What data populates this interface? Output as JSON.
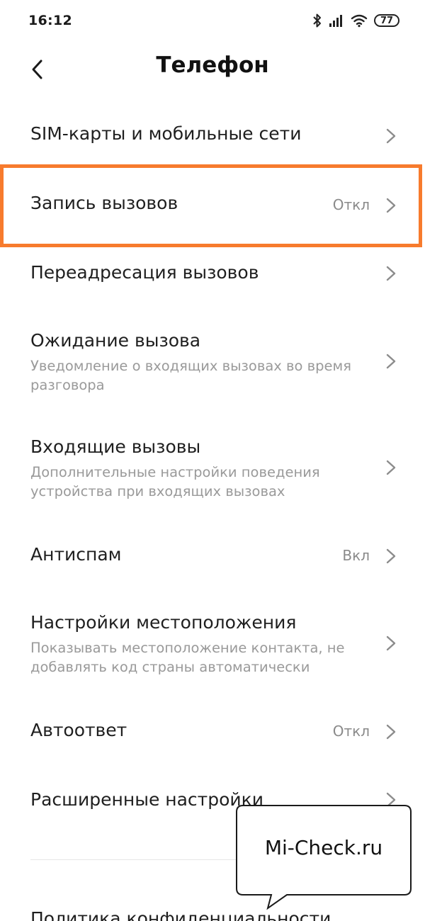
{
  "status_bar": {
    "time": "16:12",
    "battery": "77",
    "icons": [
      "bluetooth-icon",
      "signal-icon",
      "wifi-icon",
      "battery-icon"
    ]
  },
  "header": {
    "title": "Телефон",
    "back_icon": "chevron-left-icon"
  },
  "settings": {
    "items": [
      {
        "title": "SIM-карты и мобильные сети",
        "subtitle": "",
        "value": ""
      },
      {
        "title": "Запись вызовов",
        "subtitle": "",
        "value": "Откл"
      },
      {
        "title": "Переадресация вызовов",
        "subtitle": "",
        "value": ""
      },
      {
        "title": "Ожидание вызова",
        "subtitle": "Уведомление о входящих вызовах во время разговора",
        "value": ""
      },
      {
        "title": "Входящие вызовы",
        "subtitle": "Дополнительные настройки поведения устройства при входящих вызовах",
        "value": ""
      },
      {
        "title": "Антиспам",
        "subtitle": "",
        "value": "Вкл"
      },
      {
        "title": "Настройки местоположения",
        "subtitle": "Показывать местоположение контакта, не добавлять код страны автоматически",
        "value": ""
      },
      {
        "title": "Автоответ",
        "subtitle": "",
        "value": "Откл"
      },
      {
        "title": "Расширенные настройки",
        "subtitle": "",
        "value": ""
      },
      {
        "title": "Политика конфиденциальности",
        "subtitle": "",
        "value": ""
      }
    ]
  },
  "watermark": {
    "text": "Mi-Check.ru"
  },
  "colors": {
    "highlight": "#f77b2d",
    "secondary_text": "#9a9a9a",
    "value_text": "#8a8a8a",
    "chevron": "#8c8c8c"
  }
}
